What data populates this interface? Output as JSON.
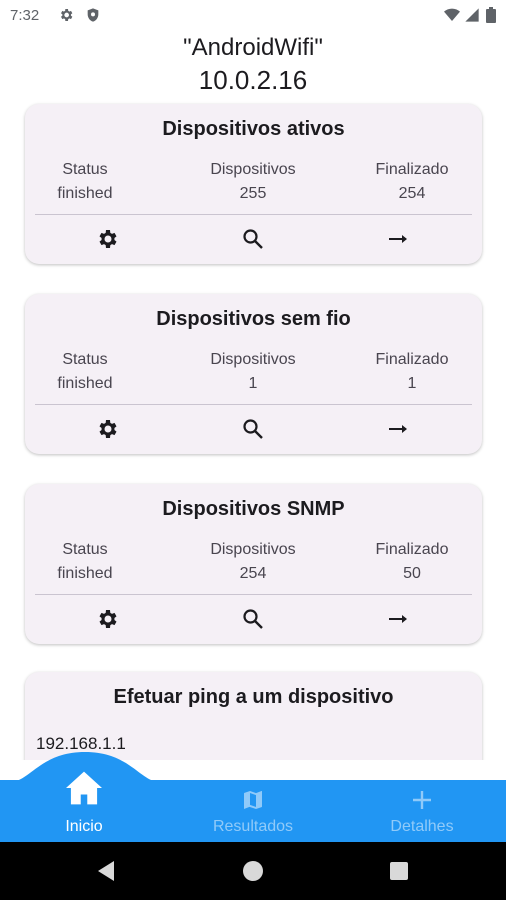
{
  "status_bar": {
    "time": "7:32"
  },
  "header": {
    "ssid": "\"AndroidWifi\"",
    "ip": "10.0.2.16"
  },
  "cards": [
    {
      "title": "Dispositivos ativos",
      "status_label": "Status",
      "status_value": "finished",
      "devices_label": "Dispositivos",
      "devices_value": "255",
      "finished_label": "Finalizado",
      "finished_value": "254"
    },
    {
      "title": "Dispositivos sem fio",
      "status_label": "Status",
      "status_value": "finished",
      "devices_label": "Dispositivos",
      "devices_value": "1",
      "finished_label": "Finalizado",
      "finished_value": "1"
    },
    {
      "title": "Dispositivos SNMP",
      "status_label": "Status",
      "status_value": "finished",
      "devices_label": "Dispositivos",
      "devices_value": "254",
      "finished_label": "Finalizado",
      "finished_value": "50"
    }
  ],
  "ping": {
    "title": "Efetuar ping a um dispositivo",
    "ip_value": "192.168.1.1"
  },
  "bottom_nav": [
    {
      "label": "Inicio",
      "icon": "home-icon",
      "active": true
    },
    {
      "label": "Resultados",
      "icon": "map-icon",
      "active": false
    },
    {
      "label": "Detalhes",
      "icon": "plus-icon",
      "active": false
    }
  ],
  "colors": {
    "accent": "#2196f3",
    "card_bg": "#f5f0f6",
    "nav_inactive": "#90caf9",
    "nav_active": "#ffffff"
  }
}
